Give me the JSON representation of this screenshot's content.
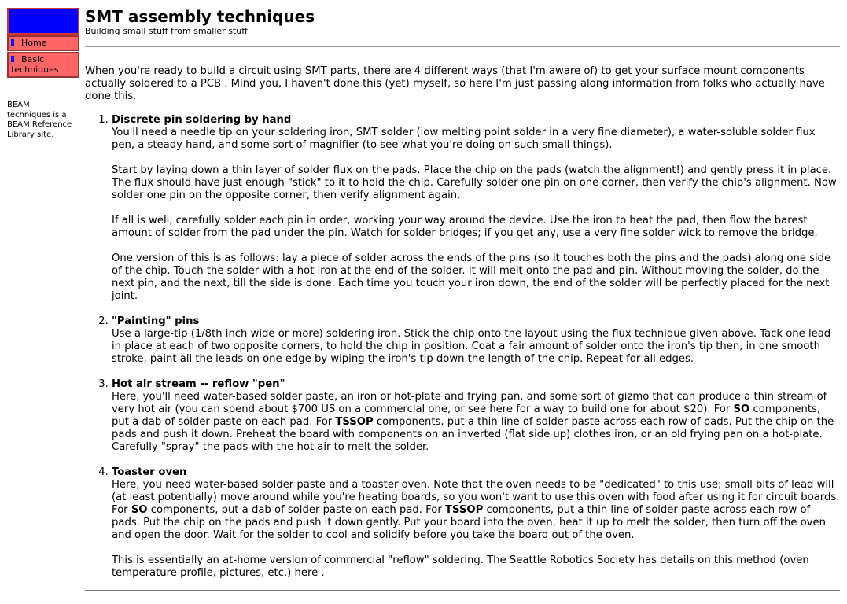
{
  "sidebar": {
    "nav": [
      {
        "label": "Home"
      },
      {
        "label": "Basic techniques"
      }
    ],
    "beam_prefix": "BEAM",
    "beam_middle": "techniques is a",
    "beam_link": "BEAM Reference",
    "beam_suffix": "Library site."
  },
  "header": {
    "title": "SMT assembly techniques",
    "subtitle": "Building small stuff from smaller stuff"
  },
  "intro": "When you're ready to build a circuit using SMT parts, there are 4 different ways (that I'm aware of) to get your surface mount components actually soldered to a PCB . Mind you, I haven't done this (yet) myself, so here I'm just passing along information from folks who actually have done this.",
  "methods": [
    {
      "title": "Discrete pin soldering by hand",
      "p1": "You'll need a needle tip on your soldering iron, SMT solder (low melting point solder in a very fine diameter), a water-soluble solder flux pen, a steady hand, and some sort of magnifier (to see what you're doing on such small things).",
      "p2": "Start by laying down a thin layer of solder flux on the pads. Place the chip on the pads (watch the alignment!) and gently press it in place. The flux should have just enough \"stick\" to it to hold the chip. Carefully solder one pin on one corner, then verify the chip's alignment. Now solder one pin on the opposite corner, then verify alignment again.",
      "p3": "If all is well, carefully solder each pin in order, working your way around the device. Use the iron to heat the pad, then flow the barest amount of solder from the pad under the pin. Watch for solder bridges; if you get any, use a very fine solder wick to remove the bridge.",
      "p4": "One version of this is as follows: lay a piece of solder across the ends of the pins (so it touches both the pins and the pads) along one side of the chip. Touch the solder with a hot iron at the end of the solder. It will melt onto the pad and pin. Without moving the solder, do the next pin, and the next, till the side is done. Each time you touch your iron down, the end of the solder will be perfectly placed for the next joint."
    },
    {
      "title": "\"Painting\" pins",
      "p1_before": "Use a large-tip ",
      "p1_mark": "(",
      "p1_after": "1/8th inch wide or more) soldering iron. Stick the chip onto the layout using the flux technique given above. Tack one lead in place at each of two opposite corners, to hold the chip in position. Coat a fair amount of solder onto the iron's tip then, in one smooth stroke, paint all the leads on one edge by wiping the iron's tip down the length of the chip. Repeat for all edges."
    },
    {
      "title": "Hot air stream -- reflow \"pen\"",
      "p1_a": "Here, you'll need water-based solder paste, an iron or hot-plate and frying pan, and some sort of gizmo that can produce a thin stream of very hot air (you can spend about $700 US on a commercial one, or see ",
      "p1_link": "here",
      "p1_b": " for a way to build one for about $20). For ",
      "so": "SO",
      "p1_c": " components, put a dab of solder paste on each pad. For ",
      "tssop": "TSSOP",
      "p1_d": " components, put a thin line of solder paste across each row of pads. Put the chip on the pads and push it down. Preheat the board with components on an inverted (flat side up) clothes iron, or an old frying pan on a hot-plate. Carefully \"spray\" the pads with the hot air to melt the solder."
    },
    {
      "title": "Toaster oven",
      "p1_a": "Here, you need water-based solder paste and a toaster oven. Note that the oven needs to be \"dedicated\" to this use; small bits of lead will (at least potentially) move around while you're heating boards, so you won't want to use this oven with food after using it for circuit boards. For ",
      "so": "SO",
      "p1_b": " components, put a dab of solder paste on each pad. For ",
      "tssop": "TSSOP",
      "p1_c": " components, put a thin line of solder paste across each row of pads. Put the chip on the pads and push it down gently. Put your board into the oven, heat it up to melt the solder, then turn off the oven and open the door. Wait for the solder to cool and solidify before you take the board out of the oven.",
      "p2_a": "This is essentially an at-home version of commercial \"reflow\" soldering. The Seattle Robotics Society has details on this method (oven temperature profile, pictures, etc.) ",
      "p2_link": "here",
      "p2_b": " ."
    }
  ]
}
